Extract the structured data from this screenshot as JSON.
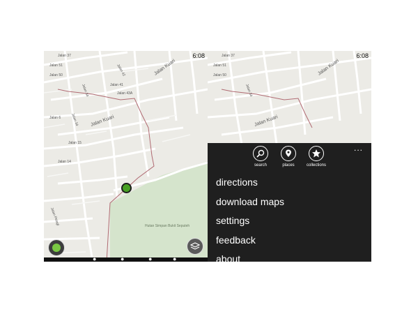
{
  "left_screen": {
    "status_time": "6:08",
    "street_labels": [
      "Jalan 37",
      "Jalan 51",
      "Jalan 50",
      "Jalan 34",
      "Jalan 42",
      "Jalan Kuari",
      "Jalan 41",
      "Jalan 43A",
      "Jalan 34",
      "Jalan Kuari",
      "Jalan 6",
      "Jalan 15",
      "Jalan 14",
      "Jalan Pelagi",
      "Hutan Simpan Bukit Seputeh"
    ],
    "locate_button_icon": "locate-me-icon",
    "layers_button_icon": "layers-icon"
  },
  "right_screen": {
    "status_time": "6:08",
    "street_labels": [
      "Jalan 37",
      "Jalan 51",
      "Jalan 50",
      "Jalan 34",
      "Jalan Kuari",
      "Jalan Kuari"
    ],
    "appbar": {
      "more_label": "...",
      "icons": [
        {
          "label": "search",
          "icon": "search-icon"
        },
        {
          "label": "places",
          "icon": "places-icon"
        },
        {
          "label": "collections",
          "icon": "star-icon"
        }
      ],
      "menu": [
        "directions",
        "download maps",
        "settings",
        "feedback",
        "about"
      ]
    }
  },
  "colors": {
    "map_background": "#ecebe6",
    "road": "#ffffff",
    "park": "#d5e4cc",
    "boundary": "#b06a72",
    "appbar_background": "#1f1f1f",
    "marker_green": "#47a023"
  }
}
